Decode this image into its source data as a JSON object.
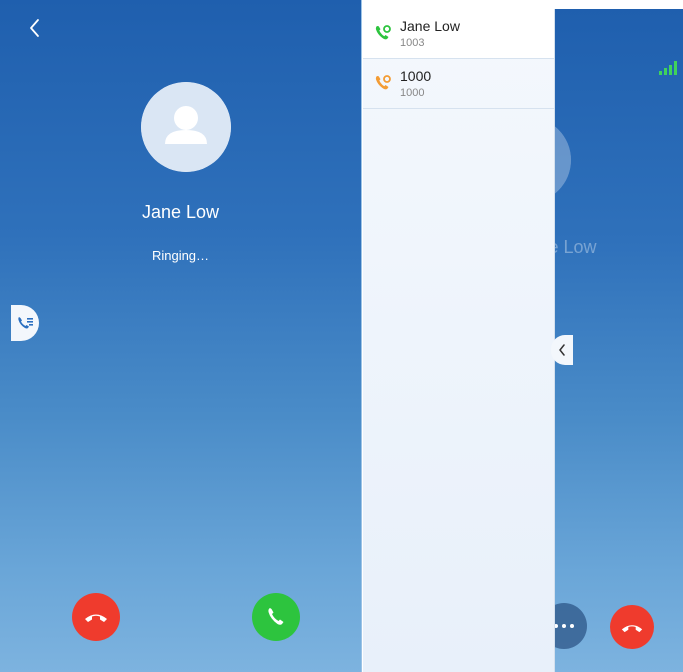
{
  "left_screen": {
    "contact_name": "Jane Low",
    "status": "Ringing…"
  },
  "right_screen": {
    "contact_name": "Jane Low",
    "calls": [
      {
        "name": "Jane Low",
        "number": "1003",
        "state": "active",
        "icon_color": "#2dc43e"
      },
      {
        "name": "1000",
        "number": "1000",
        "state": "held",
        "icon_color": "#f39c34"
      }
    ],
    "more_label": "···"
  },
  "colors": {
    "accept": "#2dc43e",
    "decline": "#ef3b2d",
    "held": "#f39c34",
    "signal": "#40d35b",
    "screen_top": "#1f5fae",
    "screen_bottom": "#7db3df"
  },
  "icons": {
    "back": "chevron-left-icon",
    "avatar": "person-icon",
    "call_list_tab": "call-list-icon",
    "decline": "hang-up-icon",
    "answer": "phone-icon",
    "collapse": "chevron-left-icon",
    "signal": "signal-strength-icon"
  }
}
